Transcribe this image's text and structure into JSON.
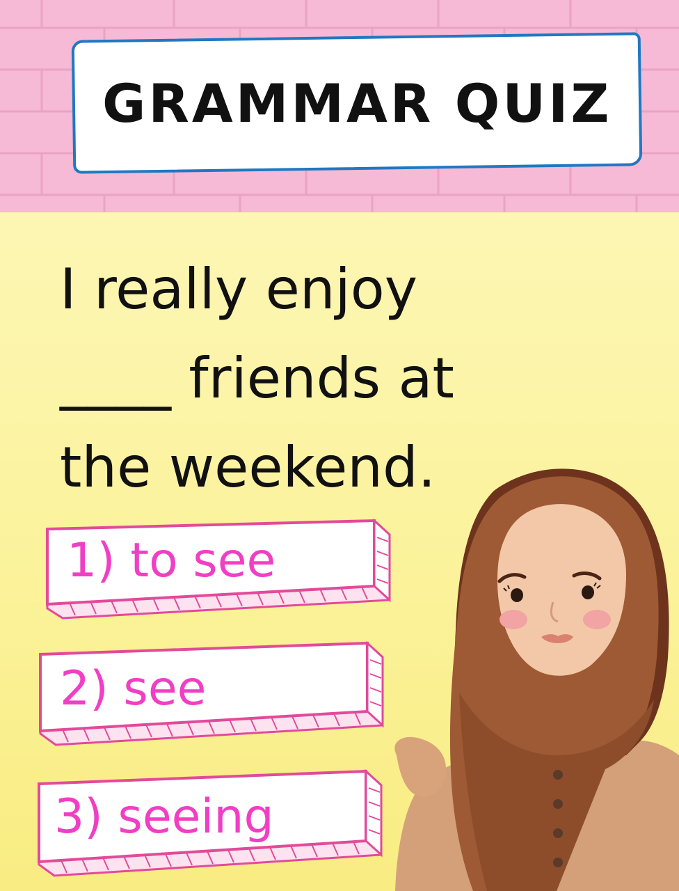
{
  "title": "GRAMMAR QUIZ",
  "question": {
    "line1": "I really enjoy",
    "line2": "____ friends at",
    "line3": "the weekend."
  },
  "options": [
    {
      "label": "1) to see"
    },
    {
      "label": "2) see"
    },
    {
      "label": "3) seeing"
    }
  ],
  "colors": {
    "top_background": "#f6b9d6",
    "title_border": "#1f78c2",
    "bottom_background": "#fbf29a",
    "option_text": "#f03fc4",
    "option_border": "#e24a9a"
  }
}
